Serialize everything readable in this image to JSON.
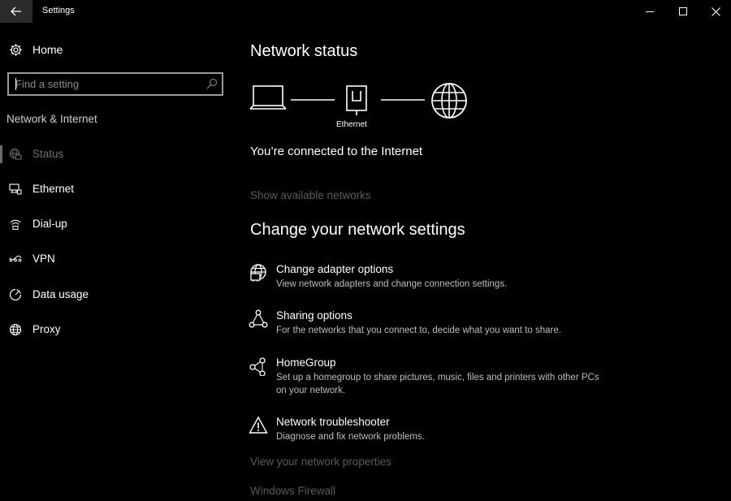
{
  "window": {
    "title": "Settings",
    "controls": {
      "minimize": "minimize-icon",
      "maximize": "maximize-icon",
      "close": "close-icon"
    }
  },
  "sidebar": {
    "home_label": "Home",
    "search": {
      "placeholder": "Find a setting",
      "value": ""
    },
    "section_title": "Network & Internet",
    "items": [
      {
        "label": "Status",
        "icon": "status-globe-icon",
        "active": true
      },
      {
        "label": "Ethernet",
        "icon": "ethernet-icon",
        "active": false
      },
      {
        "label": "Dial-up",
        "icon": "dialup-icon",
        "active": false
      },
      {
        "label": "VPN",
        "icon": "vpn-icon",
        "active": false
      },
      {
        "label": "Data usage",
        "icon": "data-usage-icon",
        "active": false
      },
      {
        "label": "Proxy",
        "icon": "globe-icon",
        "active": false
      }
    ]
  },
  "main": {
    "title": "Network status",
    "diagram": {
      "ethernet_label": "Ethernet"
    },
    "connection_status": "You’re connected to the Internet",
    "show_networks_link": "Show available networks",
    "change_heading": "Change your network settings",
    "options": [
      {
        "title": "Change adapter options",
        "description": "View network adapters and change connection settings.",
        "icon": "adapter-icon"
      },
      {
        "title": "Sharing options",
        "description": "For the networks that you connect to, decide what you want to share.",
        "icon": "sharing-icon"
      },
      {
        "title": "HomeGroup",
        "description": "Set up a homegroup to share pictures, music, files and printers with other PCs on your network.",
        "icon": "homegroup-icon"
      },
      {
        "title": "Network troubleshooter",
        "description": "Diagnose and fix network problems.",
        "icon": "warning-icon"
      }
    ],
    "properties_link": "View your network properties",
    "firewall_link": "Windows Firewall"
  },
  "colors": {
    "background": "#000000",
    "text": "#ffffff",
    "muted_link": "#5b5b5b",
    "description": "#bdbdbd"
  }
}
